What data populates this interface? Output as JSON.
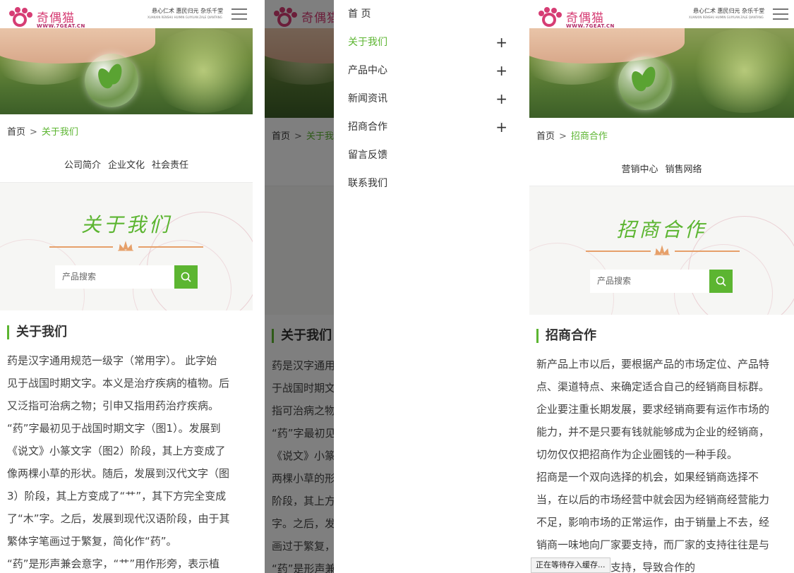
{
  "site": {
    "brand": "奇偶猫",
    "url": "WWW.7GEAT.CN",
    "slogan": "悬心仁术  惠民归元  杂乐千堂",
    "slogan_sub": "XUANXIN RENSHU HUIMIN GUIYUAN ZALE QIANTANG"
  },
  "colors": {
    "accent": "#5cb531",
    "brand": "#d63d74",
    "ornament": "#e6a06a"
  },
  "icons": {
    "menu": "hamburger-menu-icon",
    "search": "search-icon",
    "expand": "plus-icon"
  },
  "page1": {
    "breadcrumb": {
      "home": "首页",
      "sep": ">",
      "current": "关于我们"
    },
    "subnav": [
      "公司简介",
      "企业文化",
      "社会责任"
    ],
    "hero_title": "关于我们",
    "search_placeholder": "产品搜索",
    "article_title": "关于我们",
    "article_lines": [
      "药是汉字通用规范一级字（常用字）。 此字始",
      "见于战国时期文字。本义是治疗疾病的植物。后",
      "又泛指可治病之物；引申又指用药治疗疾病。",
      "“药”字最初见于战国时期文字（图1）。发展到",
      "《说文》小篆文字（图2）阶段，其上方变成了",
      "像两棵小草的形状。随后，发展到汉代文字（图",
      "3）阶段，其上方变成了“艹”，其下方完全变成",
      "了“木”字。之后，发展到现代汉语阶段，由于其",
      "繁体字笔画过于繁复，简化作“药”。",
      "“药”是形声兼会意字，“艹”用作形旁，表示植"
    ]
  },
  "page2": {
    "menu": [
      {
        "label": "首 页",
        "expandable": false,
        "active": false
      },
      {
        "label": "关于我们",
        "expandable": true,
        "active": true
      },
      {
        "label": "产品中心",
        "expandable": true,
        "active": false
      },
      {
        "label": "新闻资讯",
        "expandable": true,
        "active": false
      },
      {
        "label": "招商合作",
        "expandable": true,
        "active": false
      },
      {
        "label": "留言反馈",
        "expandable": false,
        "active": false
      },
      {
        "label": "联系我们",
        "expandable": false,
        "active": false
      }
    ],
    "expand_symbol": "+",
    "bg_breadcrumb_home": "首页",
    "bg_breadcrumb_current": "关于我",
    "bg_article_title": "关于我们",
    "bg_lines": [
      "药是汉字通用",
      "于战国时期文",
      "指可治病之物",
      "“药”字最初见",
      "《说文》小篆",
      "两棵小草的形",
      "阶段，其上方",
      "字。之后，发",
      "画过于繁复，",
      "“药”是形声兼"
    ]
  },
  "page3": {
    "breadcrumb": {
      "home": "首页",
      "sep": ">",
      "current": "招商合作"
    },
    "subnav": [
      "营销中心",
      "销售网络"
    ],
    "hero_title": "招商合作",
    "search_placeholder": "产品搜索",
    "article_title": "招商合作",
    "article_lines": [
      "新产品上市以后，要根据产品的市场定位、产品特",
      "点、渠道特点、来确定适合自己的经销商目标群。",
      "企业要注重长期发展，要求经销商要有运作市场的",
      "能力，并不是只要有钱就能够成为企业的经销商，",
      "切勿仅仅把招商作为企业圈钱的一种手段。",
      "招商是一个双向选择的机会，如果经销商选择不",
      "当，在以后的市场经营中就会因为经销商经营能力",
      "不足，影响市场的正常运作，由于销量上不去，经",
      "销商一味地向厂家要支持，而厂家的支持往往是与",
      "                    了经销商过多的支持，导致合作的"
    ]
  },
  "browser_status": "正在等待存入缓存..."
}
